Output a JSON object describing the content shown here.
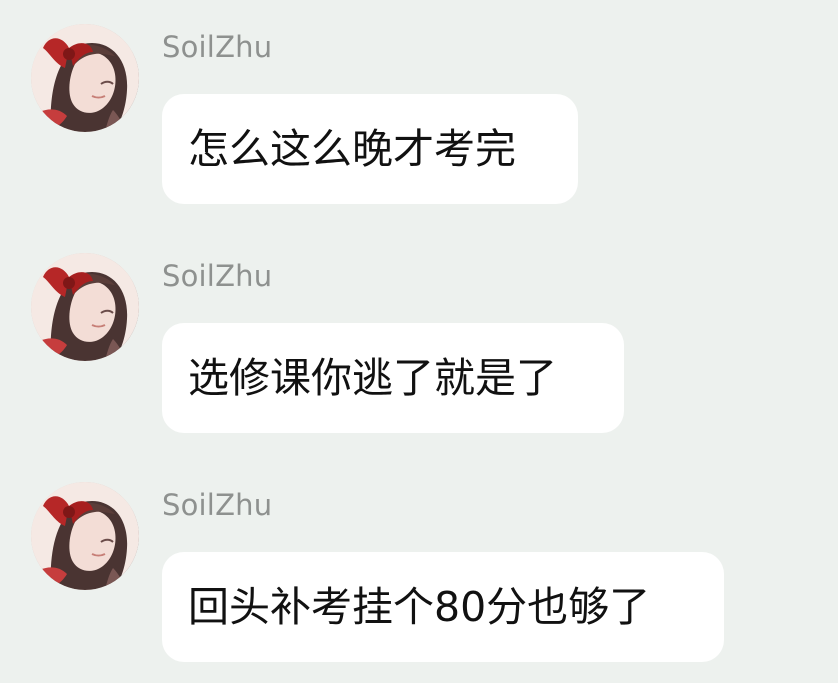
{
  "messages": [
    {
      "sender": "SoilZhu",
      "text": "怎么这么晚才考完",
      "avatar_icon": "anime-girl-avatar-icon"
    },
    {
      "sender": "SoilZhu",
      "text": "选修课你逃了就是了",
      "avatar_icon": "anime-girl-avatar-icon"
    },
    {
      "sender": "SoilZhu",
      "text": "回头补考挂个80分也够了",
      "avatar_icon": "anime-girl-avatar-icon"
    }
  ],
  "colors": {
    "background": "#edf1ee",
    "bubble": "#ffffff",
    "sender_text": "#8e918f",
    "message_text": "#111111",
    "ribbon_red": "#b52424",
    "hair_dark": "#3e2a2a"
  }
}
